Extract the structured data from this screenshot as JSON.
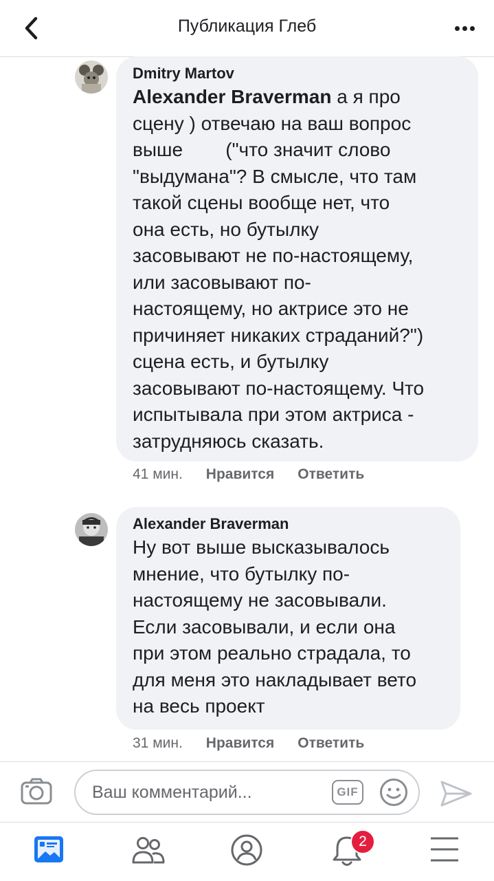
{
  "header": {
    "title": "Публикация Глеб"
  },
  "comments": [
    {
      "author": "Dmitry Martov",
      "mention": "Alexander Braverman",
      "lines": [
        " а я про",
        "сцену ) отвечаю на ваш вопрос",
        "выше        (\"что значит слово",
        "\"выдумана\"? В смысле, что там",
        "такой сцены вообще нет, что",
        "она есть, но бутылку",
        "засовывают не по-настоящему,",
        "или засовывают по-",
        "настоящему, но актрисе это не",
        "причиняет никаких страданий?\")",
        "сцена есть, и бутылку",
        "засовывают по-настоящему. Что",
        "испытывала при этом актриса -",
        "затрудняюсь сказать."
      ],
      "time": "41 мин.",
      "like": "Нравится",
      "reply": "Ответить"
    },
    {
      "author": "Alexander Braverman",
      "lines": [
        "Ну вот выше высказывалось",
        "мнение, что бутылку по-",
        "настоящему не засовывали.",
        "Если засовывали, и если она",
        "при этом реально страдала, то",
        "для меня это накладывает вето",
        "на весь проект"
      ],
      "time": "31 мин.",
      "like": "Нравится",
      "reply": "Ответить"
    }
  ],
  "composer": {
    "placeholder": "Ваш комментарий...",
    "gif_label": "GIF"
  },
  "tabbar": {
    "notifications_badge": "2"
  },
  "colors": {
    "accent": "#1877f2",
    "bubble": "#f0f2f5",
    "badge": "#e41e3f"
  },
  "icons": [
    "back-chevron-icon",
    "more-dots-icon",
    "camera-icon",
    "emoji-icon",
    "send-icon",
    "news-feed-icon",
    "friends-icon",
    "profile-icon",
    "bell-icon",
    "menu-icon"
  ]
}
